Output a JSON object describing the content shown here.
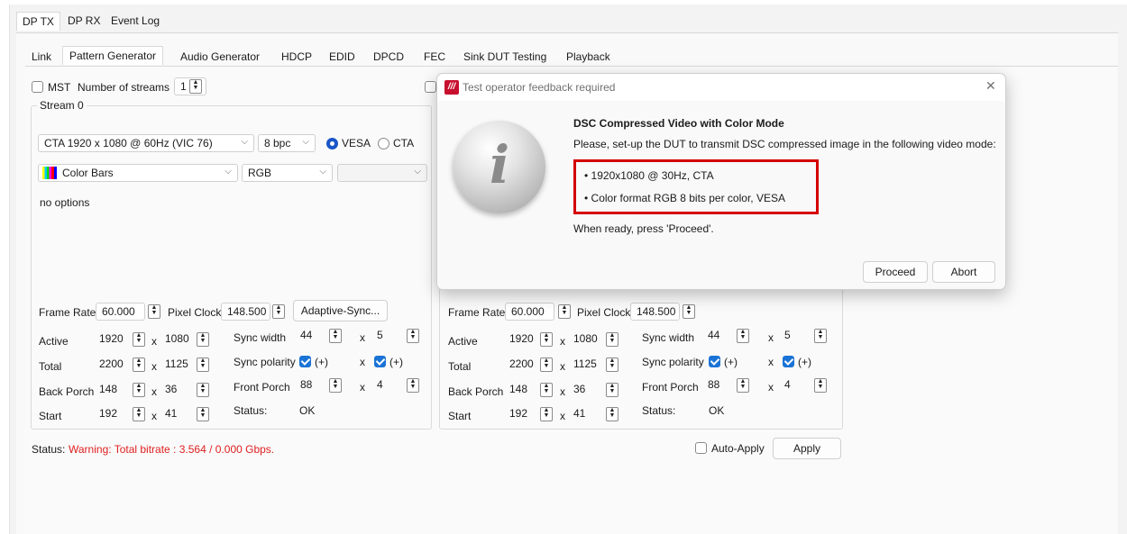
{
  "top_tabs": [
    "DP TX",
    "DP RX",
    "Event Log"
  ],
  "sub_tabs": [
    "Link",
    "Pattern Generator",
    "Audio Generator",
    "HDCP",
    "EDID",
    "DPCD",
    "FEC",
    "Sink DUT Testing",
    "Playback"
  ],
  "mst": {
    "label": "MST",
    "streams_label": "Number of streams",
    "streams_value": "1"
  },
  "stream": {
    "group_title": "Stream 0",
    "video_mode": "CTA 1920 x 1080 @ 60Hz (VIC 76)",
    "bpc": "8 bpc",
    "vesa_label": "VESA",
    "cta_label": "CTA",
    "pattern": "Color Bars",
    "color_format": "RGB",
    "options_text": "no options"
  },
  "timing_left": {
    "frame_rate_label": "Frame Rate",
    "frame_rate": "60.000",
    "pixel_clock_label": "Pixel Clock",
    "pixel_clock": "148.500",
    "adaptive_sync": "Adaptive-Sync...",
    "active_label": "Active",
    "active_h": "1920",
    "active_v": "1080",
    "total_label": "Total",
    "total_h": "2200",
    "total_v": "1125",
    "back_porch_label": "Back Porch",
    "back_porch_h": "148",
    "back_porch_v": "36",
    "start_label": "Start",
    "start_h": "192",
    "start_v": "41",
    "sync_width_label": "Sync width",
    "sync_width_h": "44",
    "sync_width_v": "5",
    "sync_polarity_label": "Sync polarity",
    "polarity_plus": "(+)",
    "front_porch_label": "Front Porch",
    "front_porch_h": "88",
    "front_porch_v": "4",
    "status_label": "Status:",
    "status_value": "OK",
    "x": "x"
  },
  "timing_right": {
    "frame_rate_label": "Frame Rate",
    "frame_rate": "60.000",
    "pixel_clock_label": "Pixel Clock",
    "pixel_clock": "148.500",
    "active_label": "Active",
    "active_h": "1920",
    "active_v": "1080",
    "total_label": "Total",
    "total_h": "2200",
    "total_v": "1125",
    "back_porch_label": "Back Porch",
    "back_porch_h": "148",
    "back_porch_v": "36",
    "start_label": "Start",
    "start_h": "192",
    "start_v": "41",
    "sync_width_label": "Sync width",
    "sync_width_h": "44",
    "sync_width_v": "5",
    "sync_polarity_label": "Sync polarity",
    "polarity_plus": "(+)",
    "front_porch_label": "Front Porch",
    "front_porch_h": "88",
    "front_porch_v": "4",
    "status_label": "Status:",
    "status_value": "OK",
    "x": "x"
  },
  "footer": {
    "status_label": "Status:",
    "status_warning": "Warning: Total bitrate : 3.564 / 0.000 Gbps.",
    "auto_apply": "Auto-Apply",
    "apply": "Apply"
  },
  "dialog": {
    "title": "Test operator feedback required",
    "heading": "DSC Compressed Video with Color Mode",
    "instruction": "Please, set-up the DUT to transmit DSC compressed image in the following video mode:",
    "bullets": [
      "1920x1080 @ 30Hz, CTA",
      "Color format RGB  8 bits per color, VESA"
    ],
    "ready_text": "When ready, press 'Proceed'.",
    "proceed": "Proceed",
    "abort": "Abort",
    "close": "✕"
  },
  "colors": {
    "accent": "#1a55c8",
    "warning": "#e02020",
    "highlight_box": "#d40000",
    "logo": "#c8102e"
  }
}
